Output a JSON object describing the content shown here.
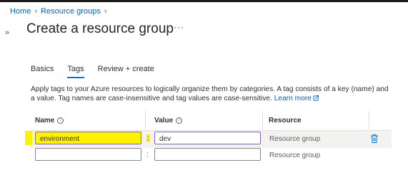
{
  "breadcrumb": {
    "home": "Home",
    "sep": "›",
    "resource_groups": "Resource groups",
    "trail": "›"
  },
  "expand_glyph": "»",
  "page": {
    "title": "Create a resource group",
    "more": "···"
  },
  "tabs": [
    {
      "label": "Basics",
      "active": false
    },
    {
      "label": "Tags",
      "active": true
    },
    {
      "label": "Review + create",
      "active": false
    }
  ],
  "description": {
    "text": "Apply tags to your Azure resources to logically organize them by categories. A tag consists of a key (name) and a value. Tag names are case-insensitive and tag values are case-sensitive.",
    "link": "Learn more"
  },
  "table": {
    "headers": {
      "name": "Name",
      "value": "Value",
      "resource": "Resource"
    },
    "info_glyph": "i",
    "rows": [
      {
        "name": "environment",
        "colon": ":",
        "value": "dev",
        "resource": "Resource group",
        "deletable": true
      },
      {
        "name": "",
        "colon": ":",
        "value": "",
        "resource": "Resource group",
        "deletable": false
      }
    ]
  },
  "colors": {
    "accent": "#0078d4",
    "link": "#0064be",
    "highlight": "#fff200",
    "focus_border": "#8764b8"
  },
  "icons": {
    "delete": "trash-icon",
    "external": "external-link-icon",
    "info": "info-icon"
  }
}
